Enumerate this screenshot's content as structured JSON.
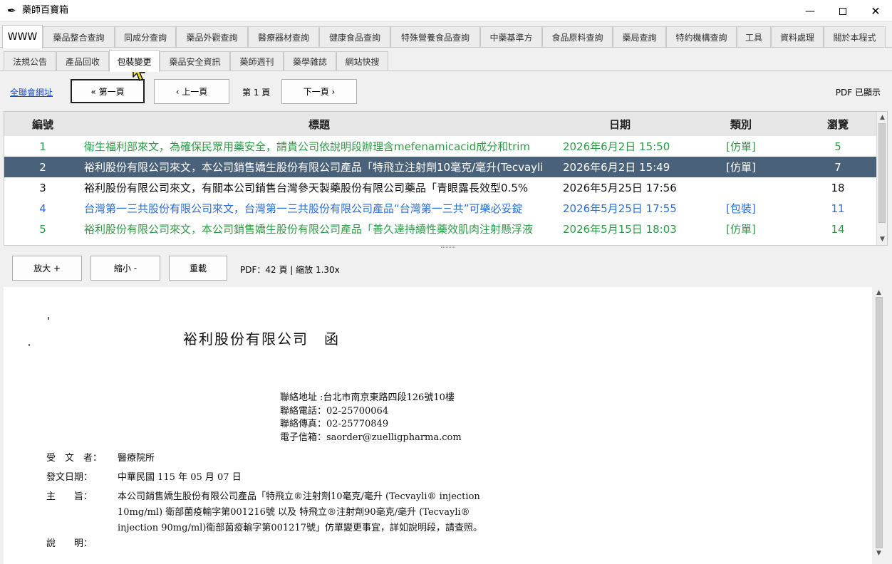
{
  "window": {
    "icon": "feather-icon",
    "title": "藥師百寶箱",
    "min_glyph": "—",
    "close_glyph": "✕"
  },
  "main_tabs": [
    {
      "label": "WWW",
      "active": true
    },
    {
      "label": "藥品整合查詢"
    },
    {
      "label": "同成分查詢"
    },
    {
      "label": "藥品外觀查詢"
    },
    {
      "label": "醫療器材查詢"
    },
    {
      "label": "健康食品查詢"
    },
    {
      "label": "特殊營養食品查詢"
    },
    {
      "label": "中藥基準方"
    },
    {
      "label": "食品原料查詢"
    },
    {
      "label": "藥局查詢"
    },
    {
      "label": "特約機構查詢"
    },
    {
      "label": "工具"
    },
    {
      "label": "資料處理"
    },
    {
      "label": "關於本程式"
    }
  ],
  "sub_tabs": [
    {
      "label": "法規公告"
    },
    {
      "label": "產品回收"
    },
    {
      "label": "包裝變更",
      "active": true
    },
    {
      "label": "藥品安全資訊"
    },
    {
      "label": "藥師週刊"
    },
    {
      "label": "藥學雜誌"
    },
    {
      "label": "網站快搜"
    }
  ],
  "nav": {
    "link": "全聯會網址",
    "first": "« 第一頁",
    "prev": "‹ 上一頁",
    "page_label": "第 1 頁",
    "next": "下一頁 ›",
    "pdf_status": "PDF 已顯示"
  },
  "table": {
    "headers": [
      "編號",
      "標題",
      "日期",
      "類別",
      "瀏覽"
    ],
    "rows": [
      {
        "num": "1",
        "title": "衛生福利部來文，為確保民眾用藥安全，請貴公司依說明段辦理含mefenamicacid成分和trim",
        "date": "2026年6月2日 15:50",
        "type": "[仿單]",
        "views": "5",
        "color": "#2e9a46"
      },
      {
        "num": "2",
        "title": "裕利股份有限公司來文，本公司銷售嬌生股份有限公司產品「特飛立注射劑10毫克/毫升(Tecvayli",
        "date": "2026年6月2日 15:49",
        "type": "[仿單]",
        "views": "7",
        "color": "#ffffff",
        "selected": true
      },
      {
        "num": "3",
        "title": "裕利股份有限公司來文，有關本公司銷售台灣參天製藥股份有限公司藥品「青眼露長效型0.5%",
        "date": "2026年5月25日 17:56",
        "type": "",
        "views": "18",
        "color": "#111111"
      },
      {
        "num": "4",
        "title": "台灣第一三共股份有限公司來文，台灣第一三共股份有限公司產品“台灣第一三共”可樂必妥錠",
        "date": "2026年5月25日 17:55",
        "type": "[包裝]",
        "views": "11",
        "color": "#2a6fd6"
      },
      {
        "num": "5",
        "title": "裕利股份有限公司來文，本公司銷售嬌生股份有限公司產品「善久達持續性藥效肌肉注射懸浮液",
        "date": "2026年5月15日 18:03",
        "type": "[仿單]",
        "views": "14",
        "color": "#2e9a46"
      }
    ]
  },
  "pdf_toolbar": {
    "zoom_in": "放大 +",
    "zoom_out": "縮小 -",
    "reset": "重載",
    "info": "PDF：42 頁 | 縮放 1.30x"
  },
  "document": {
    "company": "裕利股份有限公司　函",
    "contact": [
      "聯絡地址 :台北市南京東路四段126號10樓",
      "聯絡電話：02-25700064",
      "聯絡傳真：02-25770849",
      "電子信箱：saorder@zuelligpharma.com"
    ],
    "recipient_label": "受　文　者：",
    "recipient": "醫療院所",
    "date_label": "發文日期：",
    "date": "中華民國 115 年 05 月 07 日",
    "subject_label": "主　　旨：",
    "subject_lines": [
      "本公司銷售嬌生股份有限公司產品「特飛立®注射劑10毫克/毫升 (Tecvayli® injection",
      "10mg/ml) 衛部菌疫輸字第001216號 以及 特飛立®注射劑90毫克/毫升 (Tecvayli®",
      "injection 90mg/ml)衛部菌疫輸字第001217號」仿單變更事宜，詳如說明段，請查照。"
    ],
    "explain_label": "說　　明："
  }
}
